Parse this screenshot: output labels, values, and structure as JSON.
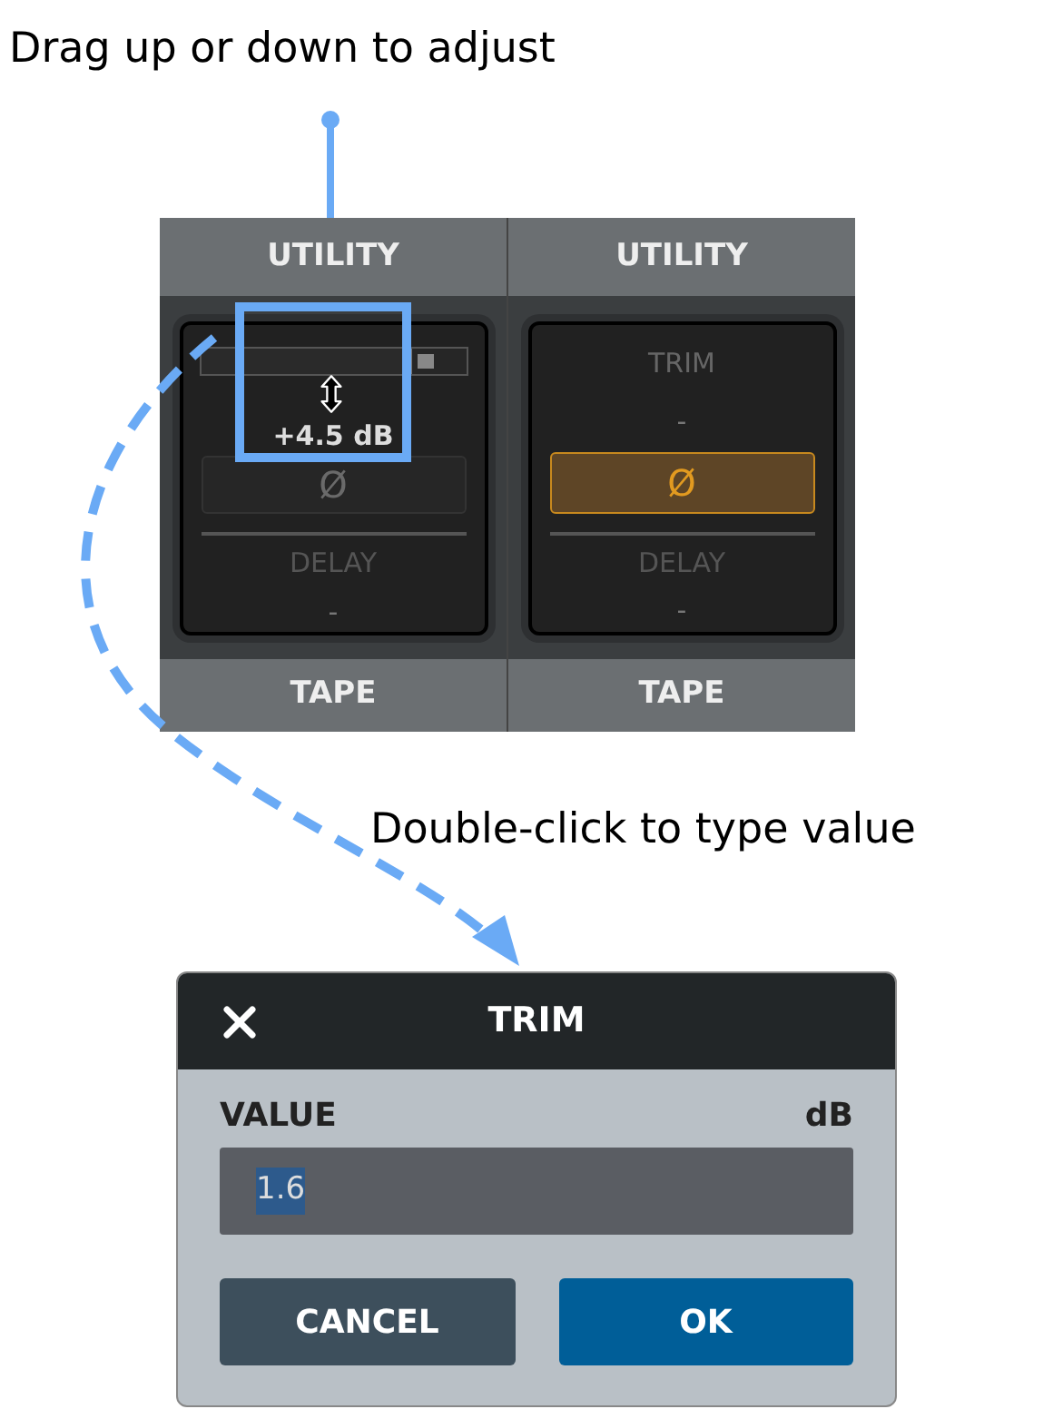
{
  "caption_top": "Drag up or down to adjust",
  "strips": [
    {
      "header": "UTILITY",
      "trim": {
        "kind": "meter",
        "level": 0.8,
        "value": "+4.5 dB"
      },
      "phase": {
        "symbol": "Ø",
        "on": false
      },
      "delay_label": "DELAY",
      "delay_value": "-",
      "footer": "TAPE"
    },
    {
      "header": "UTILITY",
      "trim": {
        "kind": "label",
        "label": "TRIM",
        "value": "-"
      },
      "phase": {
        "symbol": "Ø",
        "on": true
      },
      "delay_label": "DELAY",
      "delay_value": "-",
      "footer": "TAPE"
    }
  ],
  "caption_bottom": "Double-click to type value",
  "dialog": {
    "title": "TRIM",
    "field_label": "VALUE",
    "unit": "dB",
    "value": "1.6",
    "value_selected": true,
    "buttons": [
      {
        "label": "CANCEL",
        "kind": "secondary"
      },
      {
        "label": "OK",
        "kind": "primary"
      }
    ]
  }
}
